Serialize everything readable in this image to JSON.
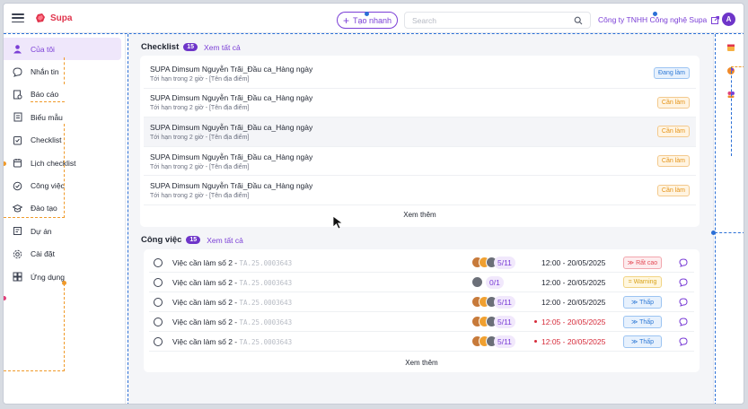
{
  "app": {
    "name": "Supa"
  },
  "topbar": {
    "create_label": "Tạo nhanh",
    "search_placeholder": "Search",
    "company": "Công ty TNHH Công nghệ Supa",
    "avatar_initial": "A"
  },
  "sidebar": {
    "items": [
      {
        "label": "Của tôi",
        "icon": "user-icon",
        "active": true
      },
      {
        "label": "Nhắn tin",
        "icon": "chat-icon"
      },
      {
        "label": "Báo cáo",
        "icon": "report-icon"
      },
      {
        "label": "Biểu mẫu",
        "icon": "forms-icon"
      },
      {
        "label": "Checklist",
        "icon": "checklist-icon"
      },
      {
        "label": "Lịch checklist",
        "icon": "calendar-icon"
      },
      {
        "label": "Công việc",
        "icon": "task-icon"
      },
      {
        "label": "Đào tạo",
        "icon": "training-icon"
      },
      {
        "label": "Dự án",
        "icon": "project-icon"
      },
      {
        "label": "Cài đặt",
        "icon": "settings-icon"
      },
      {
        "label": "Ứng dụng",
        "icon": "apps-icon"
      }
    ]
  },
  "checklist": {
    "title": "Checklist",
    "count": "15",
    "see_all": "Xem tất cả",
    "rows": [
      {
        "title": "SUPA Dimsum Nguyễn Trãi_Đầu ca_Hàng ngày",
        "sub": "Tới hạn trong 2 giờ - [Tên địa điểm]",
        "status": "Đang làm",
        "status_color": "blue"
      },
      {
        "title": "SUPA Dimsum Nguyễn Trãi_Đầu ca_Hàng ngày",
        "sub": "Tới hạn trong 2 giờ - [Tên địa điểm]",
        "status": "Cần làm",
        "status_color": "orange"
      },
      {
        "title": "SUPA Dimsum Nguyễn Trãi_Đầu ca_Hàng ngày",
        "sub": "Tới hạn trong 2 giờ - [Tên địa điểm]",
        "status": "Cần làm",
        "status_color": "orange"
      },
      {
        "title": "SUPA Dimsum Nguyễn Trãi_Đầu ca_Hàng ngày",
        "sub": "Tới hạn trong 2 giờ - [Tên địa điểm]",
        "status": "Cần làm",
        "status_color": "orange"
      },
      {
        "title": "SUPA Dimsum Nguyễn Trãi_Đầu ca_Hàng ngày",
        "sub": "Tới hạn trong 2 giờ - [Tên địa điểm]",
        "status": "Cần làm",
        "status_color": "orange"
      }
    ],
    "more": "Xem thêm"
  },
  "tasks": {
    "title": "Công việc",
    "count": "15",
    "see_all": "Xem tất cả",
    "rows": [
      {
        "name": "Việc cần làm số 2 - ",
        "code": "TA.25.0003643",
        "progress": "5/11",
        "time": "12:00 - 20/05/2025",
        "late": false,
        "priority": "Rất cao",
        "priority_color": "red",
        "priority_icon": "double-chevron-up-icon"
      },
      {
        "name": "Việc cần làm số 2 - ",
        "code": "TA.25.0003643",
        "progress": "0/1",
        "time": "12:00 - 20/05/2025",
        "late": false,
        "priority": "Warning",
        "priority_color": "yellow",
        "priority_icon": "equals-icon"
      },
      {
        "name": "Việc cần làm số 2 - ",
        "code": "TA.25.0003643",
        "progress": "5/11",
        "time": "12:00 - 20/05/2025",
        "late": false,
        "priority": "Thấp",
        "priority_color": "blue",
        "priority_icon": "double-chevron-down-icon"
      },
      {
        "name": "Việc cần làm số 2 - ",
        "code": "TA.25.0003643",
        "progress": "5/11",
        "time": "12:05 - 20/05/2025",
        "late": true,
        "priority": "Thấp",
        "priority_color": "blue",
        "priority_icon": "double-chevron-down-icon"
      },
      {
        "name": "Việc cần làm số 2 - ",
        "code": "TA.25.0003643",
        "progress": "5/11",
        "time": "12:05 - 20/05/2025",
        "late": true,
        "priority": "Thấp",
        "priority_color": "blue",
        "priority_icon": "double-chevron-down-icon"
      }
    ],
    "more": "Xem thêm"
  },
  "colors": {
    "accent": "#7b3fd6",
    "brand": "#e0344c",
    "overlay_blue": "#2a6fd6",
    "overlay_orange": "#f09a2a",
    "overlay_pink": "#e0407a"
  }
}
